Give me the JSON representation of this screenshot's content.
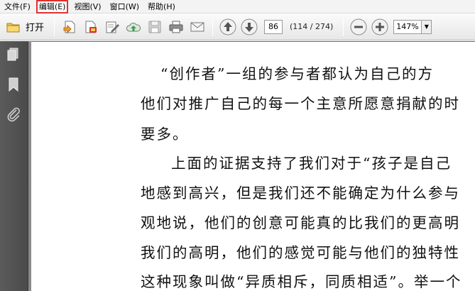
{
  "menu": {
    "items": [
      {
        "label": "文件(F)"
      },
      {
        "label": "编辑(E)"
      },
      {
        "label": "视图(V)"
      },
      {
        "label": "窗口(W)"
      },
      {
        "label": "帮助(H)"
      }
    ]
  },
  "toolbar": {
    "open_label": "打开",
    "page_number": "86",
    "page_count": "(114 / 274)",
    "zoom": "147%"
  },
  "document": {
    "lines": [
      "“创作者”一组的参与者都认为自己的方",
      "他们对推广自己的每一个主意所愿意捐献的时",
      "要多。",
      "上面的证据支持了我们对于“孩子是自己",
      "地感到高兴，但是我们还不能确定为什么参与",
      "观地说，他们的创意可能真的比我们的更高明",
      "我们的高明，他们的感觉可能与他们的独特性",
      "这种现象叫做“异质相斥，同质相适”。举一个"
    ]
  }
}
